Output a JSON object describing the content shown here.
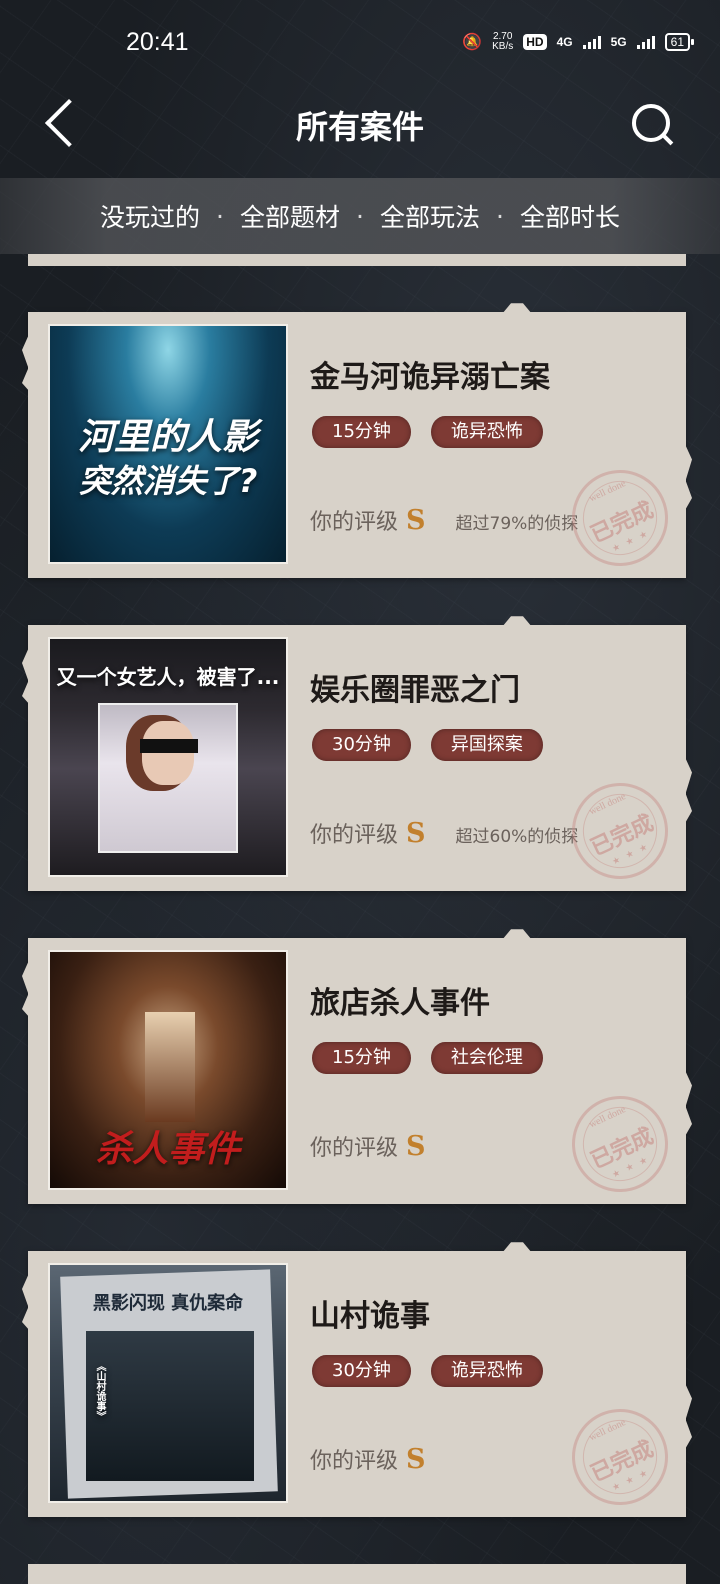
{
  "status": {
    "time": "20:41",
    "net_speed_value": "2.70",
    "net_speed_unit": "KB/s",
    "hd_badge": "HD",
    "net1": "4G",
    "net2": "5G",
    "battery": "61"
  },
  "header": {
    "title": "所有案件"
  },
  "filters": {
    "played": "没玩过的",
    "theme": "全部题材",
    "mode": "全部玩法",
    "duration": "全部时长",
    "separator": "·"
  },
  "stamp": {
    "top": "well done",
    "main": "已完成",
    "stars": "★ ★ ★"
  },
  "cards": [
    {
      "title": "金马河诡异溺亡案",
      "duration": "15分钟",
      "genre": "诡异恐怖",
      "rating_label": "你的评级",
      "grade": "S",
      "note": "超过79%的侦探",
      "thumb_text_line1": "河里的人影",
      "thumb_text_line2": "突然消失了?"
    },
    {
      "title": "娱乐圈罪恶之门",
      "duration": "30分钟",
      "genre": "异国探案",
      "rating_label": "你的评级",
      "grade": "S",
      "note": "超过60%的侦探",
      "thumb_text_line1": "又一个女艺人，被害了..."
    },
    {
      "title": "旅店杀人事件",
      "duration": "15分钟",
      "genre": "社会伦理",
      "rating_label": "你的评级",
      "grade": "S",
      "thumb_text_line1": "杀人事件"
    },
    {
      "title": "山村诡事",
      "duration": "30分钟",
      "genre": "诡异恐怖",
      "rating_label": "你的评级",
      "grade": "S",
      "thumb_text_line1": "黑影闪现  真仇案命",
      "thumb_text_line2": "《山村诡事》"
    }
  ]
}
